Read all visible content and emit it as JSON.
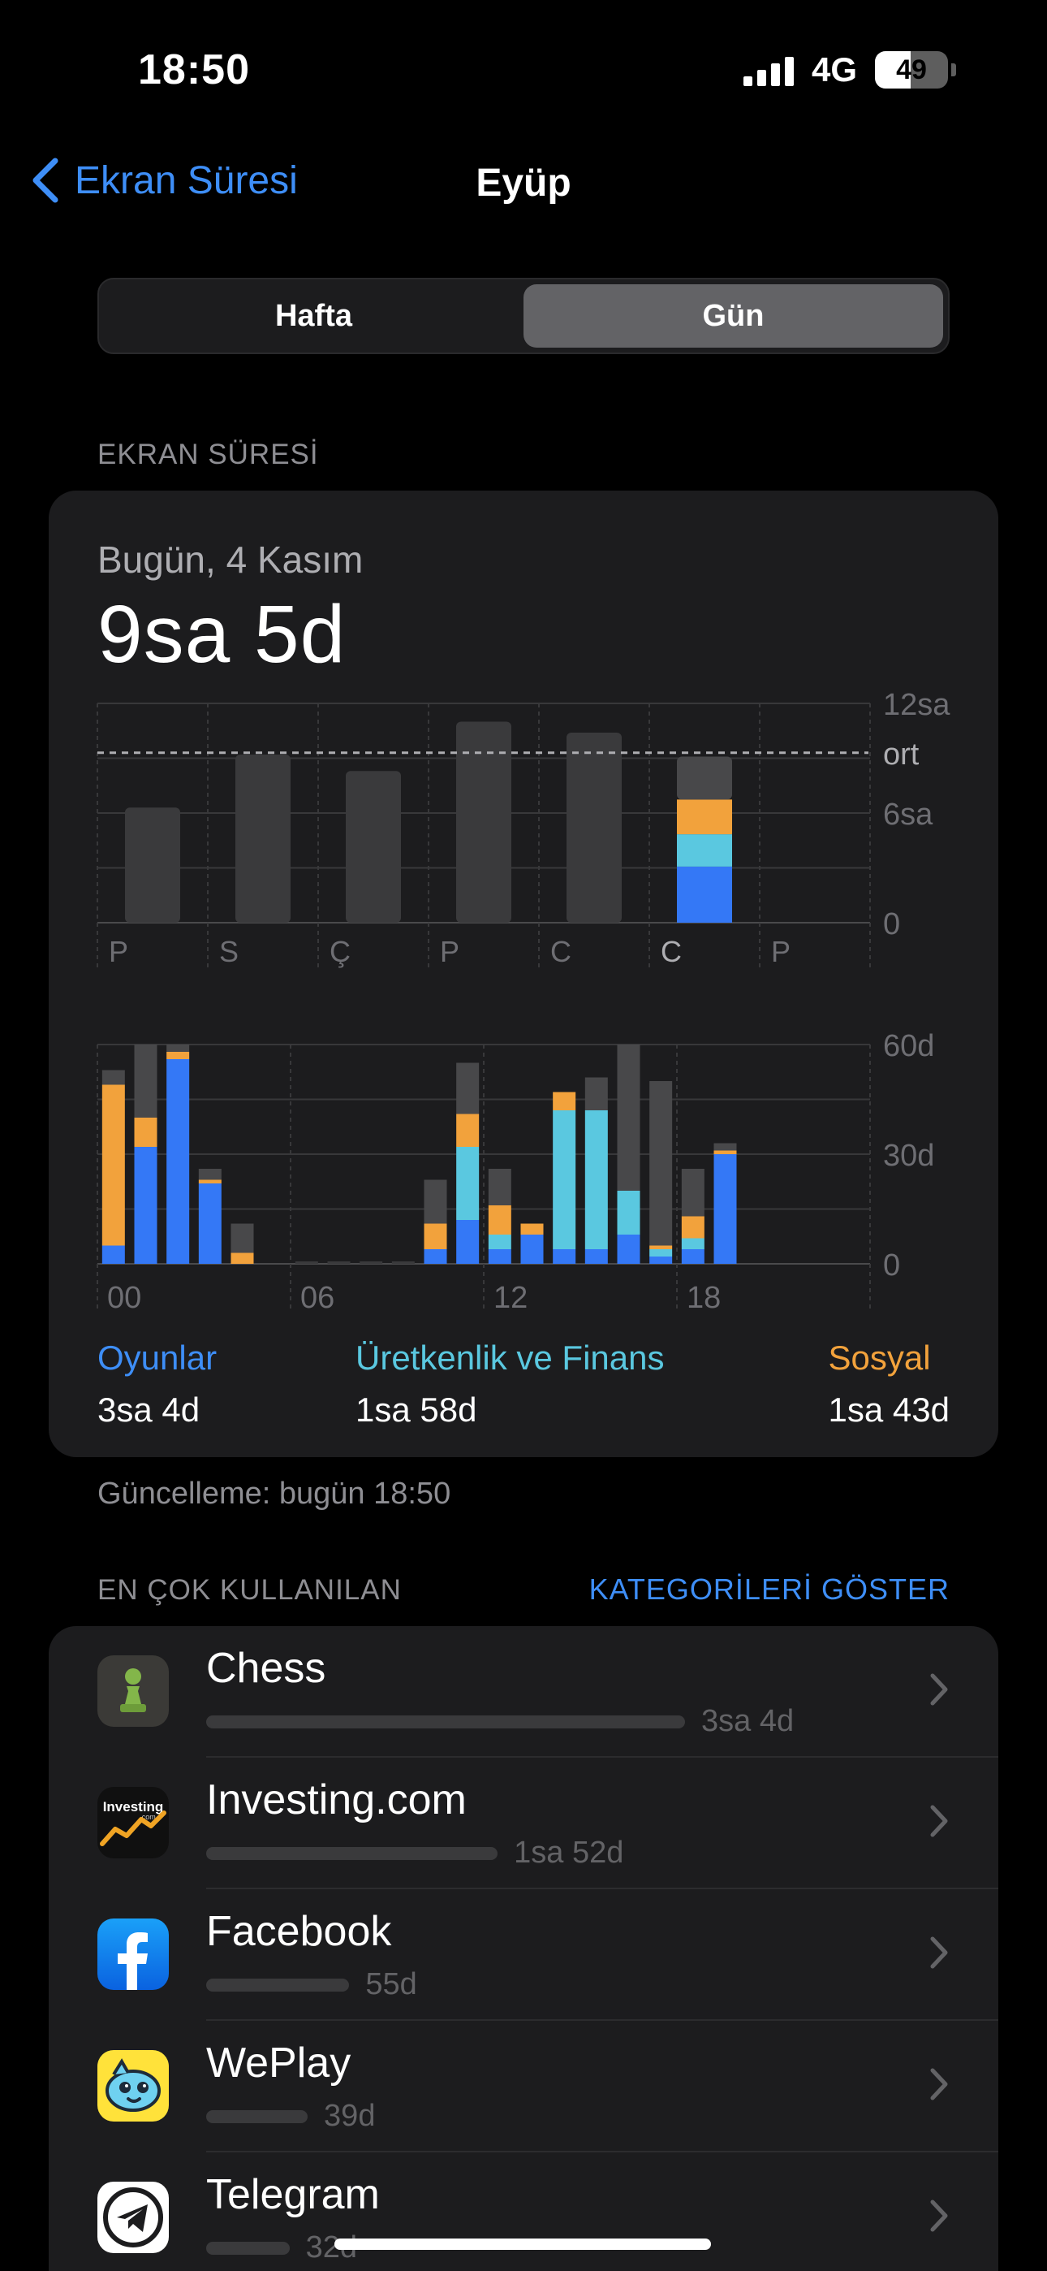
{
  "status_bar": {
    "time": "18:50",
    "network": "4G",
    "battery": "49",
    "battery_level": 0.49
  },
  "nav": {
    "back_label": "Ekran Süresi",
    "title": "Eyüp"
  },
  "segmented": {
    "week": "Hafta",
    "day": "Gün",
    "selected": "day"
  },
  "section_screen_time": "EKRAN SÜRESİ",
  "summary": {
    "date": "Bugün, 4 Kasım",
    "total": "9sa 5d"
  },
  "colors": {
    "games": "#3478f6",
    "productivity": "#5ac8e0",
    "social": "#f2a23c",
    "other": "#3a3a3c",
    "accent": "#3e8ef7"
  },
  "chart_data": [
    {
      "type": "bar",
      "categories": [
        "P",
        "S",
        "Ç",
        "P",
        "C",
        "C",
        "P"
      ],
      "series": [
        {
          "name": "Oyunlar",
          "values": [
            0,
            0,
            0,
            0,
            0,
            0,
            0
          ]
        },
        {
          "name": "Üretkenlik ve Finans",
          "values": [
            0,
            0,
            0,
            0,
            0,
            0,
            0
          ]
        },
        {
          "name": "Sosyal",
          "values": [
            0,
            0,
            0,
            0,
            0,
            0,
            0
          ]
        }
      ],
      "daily_totals_hours": [
        6.3,
        9.2,
        8.3,
        11.0,
        10.4,
        9.1,
        0
      ],
      "today_breakdown_hours": {
        "Oyunlar": 3.07,
        "Üretkenlik ve Finans": 1.77,
        "Sosyal": 1.9,
        "other": 2.35
      },
      "average_hours": 9.3,
      "ytick_labels": [
        "12sa",
        "ort",
        "6sa",
        "0"
      ],
      "ylim": [
        0,
        12
      ],
      "highlight_index": 5
    },
    {
      "type": "bar",
      "stacked": true,
      "x": [
        0,
        1,
        2,
        3,
        4,
        5,
        6,
        7,
        8,
        9,
        10,
        11,
        12,
        13,
        14,
        15,
        16,
        17,
        18,
        19,
        20,
        21,
        22,
        23
      ],
      "series": [
        {
          "name": "Oyunlar",
          "values": [
            5,
            32,
            56,
            22,
            0,
            0,
            0,
            0,
            0,
            0,
            4,
            12,
            4,
            8,
            4,
            4,
            8,
            2,
            4,
            30,
            0,
            0,
            0,
            0
          ]
        },
        {
          "name": "Üretkenlik ve Finans",
          "values": [
            0,
            0,
            0,
            0,
            0,
            0,
            0,
            0,
            0,
            0,
            0,
            20,
            4,
            0,
            38,
            38,
            12,
            2,
            3,
            0,
            0,
            0,
            0,
            0
          ]
        },
        {
          "name": "Sosyal",
          "values": [
            44,
            8,
            2,
            1,
            3,
            0,
            0,
            0,
            0,
            0,
            7,
            9,
            8,
            3,
            5,
            0,
            0,
            1,
            6,
            1,
            0,
            0,
            0,
            0
          ]
        },
        {
          "name": "other",
          "values": [
            4,
            20,
            2,
            3,
            8,
            0,
            0,
            0,
            0,
            0,
            12,
            14,
            10,
            0,
            0,
            9,
            40,
            45,
            13,
            2,
            0,
            0,
            0,
            0
          ]
        }
      ],
      "xtick_labels": [
        "00",
        "06",
        "12",
        "18"
      ],
      "ytick_labels": [
        "60d",
        "30d",
        "0"
      ],
      "ylim": [
        0,
        60
      ]
    }
  ],
  "legend": [
    {
      "label": "Oyunlar",
      "value": "3sa 4d"
    },
    {
      "label": "Üretkenlik ve Finans",
      "value": "1sa 58d"
    },
    {
      "label": "Sosyal",
      "value": "1sa 43d"
    }
  ],
  "updated": "Güncelleme: bugün 18:50",
  "most_used": {
    "title": "EN ÇOK KULLANILAN",
    "action": "KATEGORİLERİ GÖSTER"
  },
  "apps": [
    {
      "name": "Chess",
      "time": "3sa 4d",
      "minutes": 184,
      "icon": "chess-pawn-icon"
    },
    {
      "name": "Investing.com",
      "time": "1sa 52d",
      "minutes": 112,
      "icon": "investing-icon",
      "icon_text": "Investing",
      "icon_subtext": ".com"
    },
    {
      "name": "Facebook",
      "time": "55d",
      "minutes": 55,
      "icon": "facebook-icon"
    },
    {
      "name": "WePlay",
      "time": "39d",
      "minutes": 39,
      "icon": "weplay-icon"
    },
    {
      "name": "Telegram",
      "time": "32d",
      "minutes": 32,
      "icon": "telegram-icon"
    }
  ]
}
